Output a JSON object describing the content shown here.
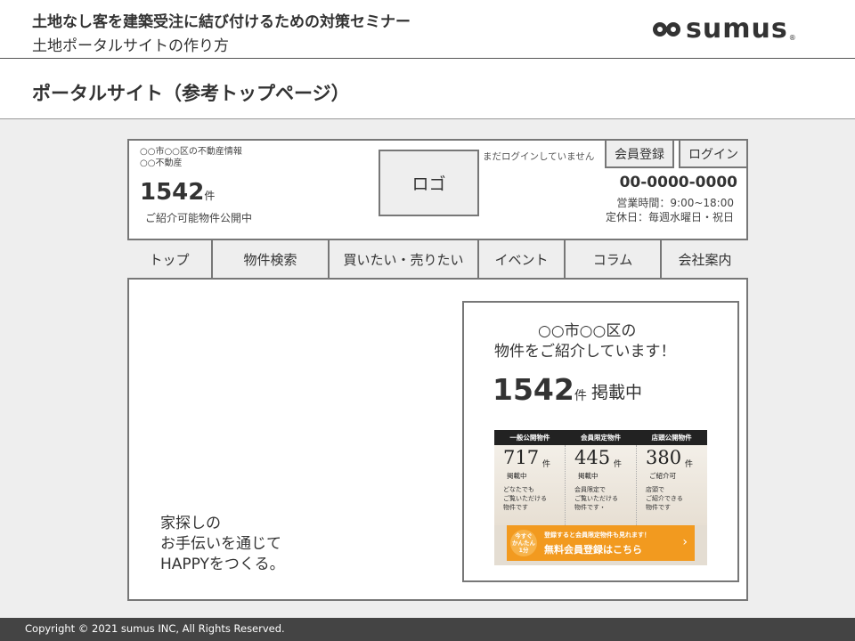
{
  "slide": {
    "title": "土地なし客を建築受注に結び付けるための対策セミナー",
    "subtitle": "土地ポータルサイトの作り方",
    "brand": "sumus",
    "brand_mark": "®",
    "section_title": "ポータルサイト（参考トップページ）"
  },
  "site_header": {
    "area_line1": "○○市○○区の不動産情報",
    "area_line2": "○○不動産",
    "count": "1542",
    "count_unit": "件",
    "count_caption": "ご紹介可能物件公開中",
    "logo_placeholder": "ロゴ",
    "login_status": "まだログインしていません",
    "register_label": "会員登録",
    "login_label": "ログイン",
    "phone": "00-0000-0000",
    "hours": "営業時間：9:00~18:00",
    "holiday": "定休日：毎週水曜日・祝日"
  },
  "nav": {
    "items": [
      "トップ",
      "物件検索",
      "買いたい・売りたい",
      "イベント",
      "コラム",
      "会社案内"
    ]
  },
  "hero": {
    "tagline_line1": "家探しの",
    "tagline_line2": "お手伝いを通じて",
    "tagline_line3": "HAPPYをつくる。"
  },
  "info_box": {
    "line1": "○○市○○区の",
    "line2": "物件をご紹介しています！",
    "count": "1542",
    "count_unit": "件",
    "suffix": "掲載中"
  },
  "banner": {
    "columns": [
      {
        "head": "一般公開物件",
        "num": "717",
        "unit": "件",
        "sub": "掲載中",
        "desc1": "どなたでも",
        "desc2": "ご覧いただける",
        "desc3": "物件です"
      },
      {
        "head": "会員限定物件",
        "num": "445",
        "unit": "件",
        "sub": "掲載中",
        "desc1": "会員限定で",
        "desc2": "ご覧いただける",
        "desc3": "物件です・"
      },
      {
        "head": "店頭公開物件",
        "num": "380",
        "unit": "件",
        "sub": "ご紹介可",
        "desc1": "店頭で",
        "desc2": "ご紹介できる",
        "desc3": "物件です"
      }
    ],
    "cta_badge_1": "今すぐ",
    "cta_badge_2": "かんたん",
    "cta_badge_3": "1分",
    "cta_line1": "登録すると会員限定物件も見れます！",
    "cta_line2": "無料会員登録はこちら",
    "cta_arrow": "›"
  },
  "footer": {
    "copyright": "Copyright © 2021 sumus INC, All Rights Reserved."
  },
  "colors": {
    "cta": "#f29a1f",
    "footer": "#444444",
    "wireframe_fill": "#eeeeee"
  }
}
